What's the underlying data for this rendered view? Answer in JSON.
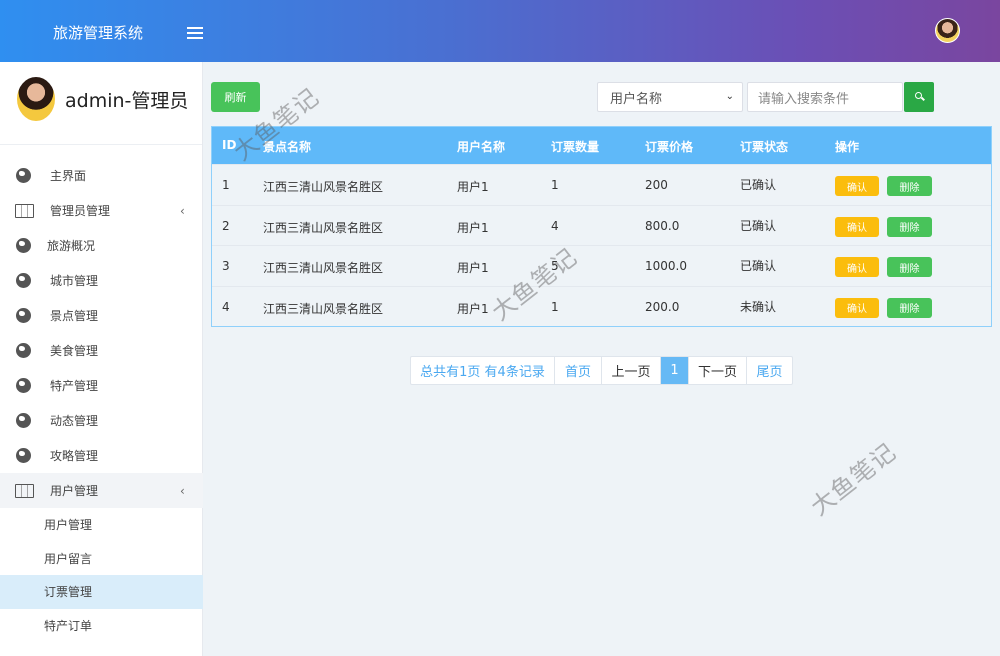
{
  "header": {
    "title": "旅游管理系统"
  },
  "profile": {
    "name": "admin-管理员"
  },
  "sidebar": {
    "items": [
      {
        "label": "主界面",
        "icon": "globe-icon"
      },
      {
        "label": "管理员管理",
        "icon": "map-icon",
        "caret": "‹"
      },
      {
        "label": "旅游概况",
        "icon": "globe-icon"
      },
      {
        "label": "城市管理",
        "icon": "globe-icon"
      },
      {
        "label": "景点管理",
        "icon": "globe-icon"
      },
      {
        "label": "美食管理",
        "icon": "globe-icon"
      },
      {
        "label": "特产管理",
        "icon": "globe-icon"
      },
      {
        "label": "动态管理",
        "icon": "globe-icon"
      },
      {
        "label": "攻略管理",
        "icon": "globe-icon"
      },
      {
        "label": "用户管理",
        "icon": "map-icon",
        "caret": "‹"
      }
    ],
    "subitems": [
      {
        "label": "用户管理"
      },
      {
        "label": "用户留言"
      },
      {
        "label": "订票管理",
        "active": true
      },
      {
        "label": "特产订单"
      }
    ]
  },
  "toolbar": {
    "refresh_label": "刷新",
    "select_value": "用户名称",
    "search_placeholder": "请输入搜索条件"
  },
  "table": {
    "headers": [
      "ID",
      "景点名称",
      "用户名称",
      "订票数量",
      "订票价格",
      "订票状态",
      "操作"
    ],
    "rows": [
      {
        "id": "1",
        "spot": "江西三清山风景名胜区",
        "user": "用户1",
        "qty": "1",
        "price": "200",
        "status": "已确认"
      },
      {
        "id": "2",
        "spot": "江西三清山风景名胜区",
        "user": "用户1",
        "qty": "4",
        "price": "800.0",
        "status": "已确认"
      },
      {
        "id": "3",
        "spot": "江西三清山风景名胜区",
        "user": "用户1",
        "qty": "5",
        "price": "1000.0",
        "status": "已确认"
      },
      {
        "id": "4",
        "spot": "江西三清山风景名胜区",
        "user": "用户1",
        "qty": "1",
        "price": "200.0",
        "status": "未确认"
      }
    ],
    "confirm_label": "确认",
    "delete_label": "删除"
  },
  "pagination": {
    "summary": "总共有1页  有4条记录",
    "first": "首页",
    "prev": "上一页",
    "current": "1",
    "next": "下一页",
    "last": "尾页"
  },
  "watermark": {
    "text": "大鱼笔记"
  },
  "colors": {
    "accent": "#5fb9f9",
    "success": "#48c35a",
    "warning": "#fbbd0d",
    "header_start": "#2f8ff0",
    "header_end": "#7a469f"
  }
}
